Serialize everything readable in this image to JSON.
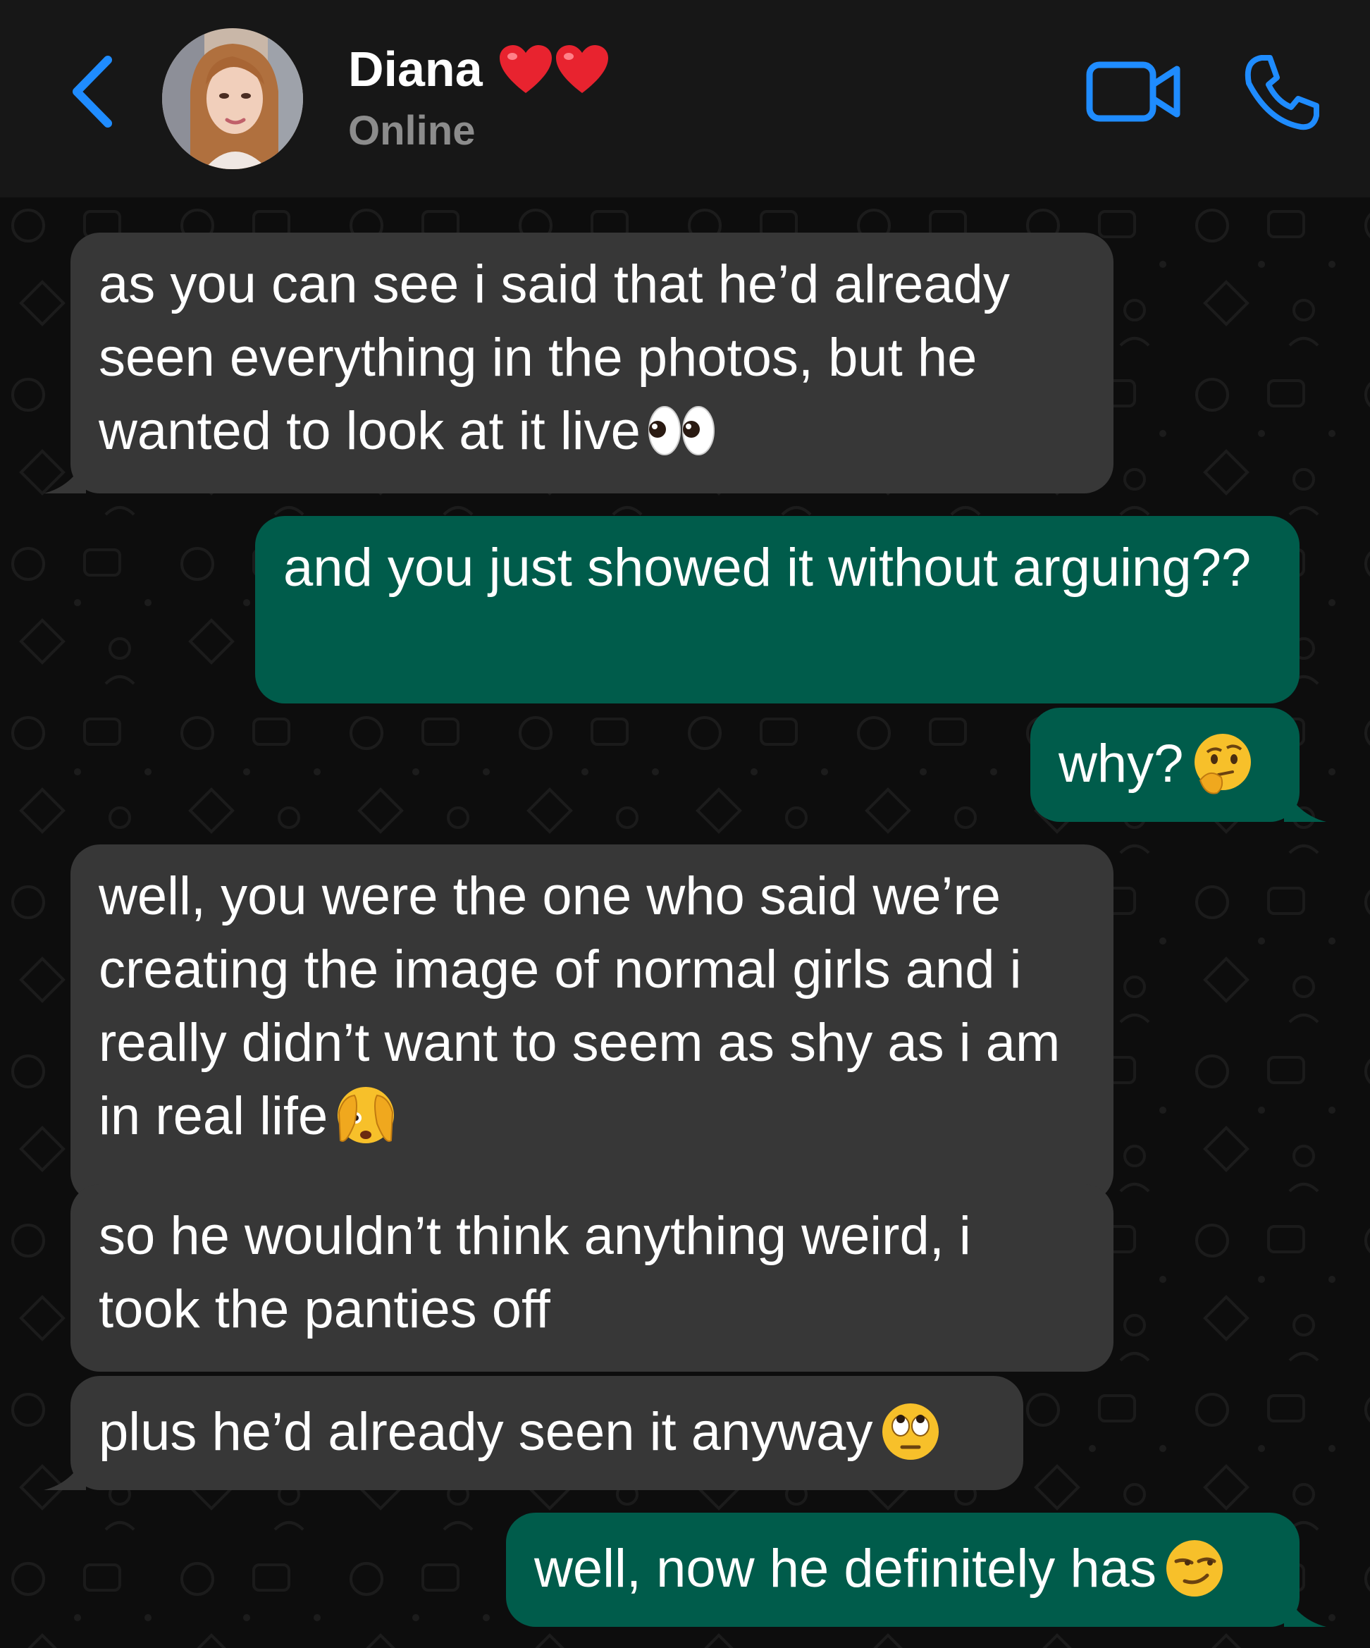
{
  "header": {
    "contact_name": "Diana",
    "status": "Online",
    "accent_color": "#1f8cff",
    "icons": [
      "back-icon",
      "avatar",
      "heart-emoji",
      "video-call-icon",
      "phone-call-icon"
    ]
  },
  "messages": [
    {
      "side": "incoming",
      "text": "as you can see i said that he’d already seen everything in the photos, but he wanted to look at it live",
      "emoji": "eyes"
    },
    {
      "side": "outgoing",
      "text": "and you just showed it without arguing??"
    },
    {
      "side": "outgoing",
      "text": "why?",
      "emoji": "thinking-face"
    },
    {
      "side": "incoming",
      "text": "well, you were the one who said we’re creating the image of normal girls and i really didn’t want to seem as shy as i am in real life",
      "emoji": "face-with-peeking-eye"
    },
    {
      "side": "incoming",
      "text": "so he wouldn’t think anything weird, i took the panties off"
    },
    {
      "side": "incoming",
      "text": "plus he’d already seen it anyway",
      "emoji": "rolling-eyes"
    },
    {
      "side": "outgoing",
      "text": "well, now he definitely has",
      "emoji": "smirking-face"
    }
  ],
  "colors": {
    "header_bg": "#171717",
    "chat_bg": "#0d0d0d",
    "incoming_bubble": "#373737",
    "outgoing_bubble": "#005c4b"
  }
}
